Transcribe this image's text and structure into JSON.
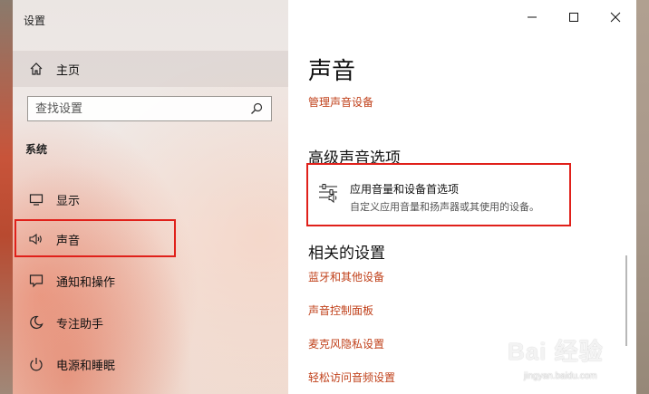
{
  "window": {
    "title": "设置",
    "controls": [
      "minimize-icon",
      "maximize-icon",
      "close-icon"
    ]
  },
  "sidebar": {
    "home_label": "主页",
    "search": {
      "placeholder": "查找设置"
    },
    "section_label": "系统",
    "items": [
      {
        "label": "显示",
        "icon": "display-icon"
      },
      {
        "label": "声音",
        "icon": "speaker-icon",
        "selected": true
      },
      {
        "label": "通知和操作",
        "icon": "notification-icon"
      },
      {
        "label": "专注助手",
        "icon": "moon-icon"
      },
      {
        "label": "电源和睡眠",
        "icon": "power-icon"
      }
    ]
  },
  "main": {
    "page_title": "声音",
    "manage_link": "管理声音设备",
    "advanced_heading": "高级声音选项",
    "advanced_item": {
      "title": "应用音量和设备首选项",
      "description": "自定义应用音量和扬声器或其使用的设备。",
      "icon": "sliders-speaker-icon"
    },
    "related_heading": "相关的设置",
    "related_links": [
      "蓝牙和其他设备",
      "声音控制面板",
      "麦克风隐私设置",
      "轻松访问音频设置"
    ]
  },
  "highlight_color": "#e0201a",
  "link_color": "#c0401a",
  "watermark": {
    "main": "Bai 经验",
    "sub": "jingyan.baidu.com"
  }
}
